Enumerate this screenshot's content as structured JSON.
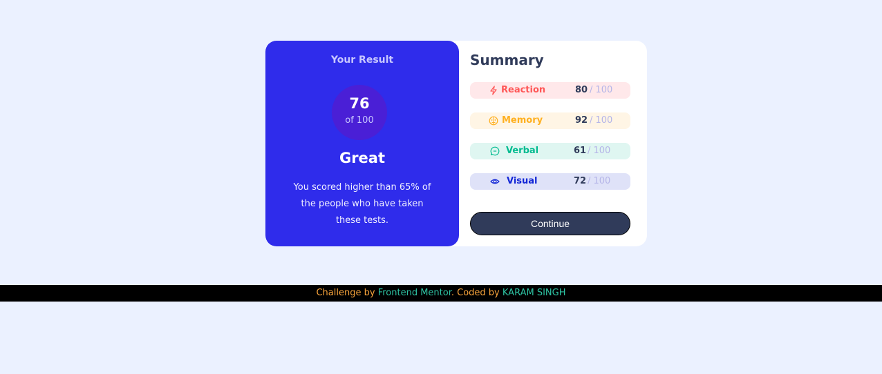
{
  "result": {
    "title": "Your Result",
    "score": "76",
    "score_of": "of 100",
    "rating": "Great",
    "description": "You scored higher than 65% of the people who have taken these tests."
  },
  "summary": {
    "title": "Summary",
    "items": [
      {
        "label": "Reaction",
        "score": "80",
        "total": "/ 100",
        "icon": "lightning-icon",
        "color": "#ff5757",
        "bg": "#ffe8ea"
      },
      {
        "label": "Memory",
        "score": "92",
        "total": "/ 100",
        "icon": "brain-icon",
        "color": "#ffb01f",
        "bg": "#fff5e5"
      },
      {
        "label": "Verbal",
        "score": "61",
        "total": "/ 100",
        "icon": "chat-icon",
        "color": "#00bb8f",
        "bg": "#dff6f1"
      },
      {
        "label": "Visual",
        "score": "72",
        "total": "/ 100",
        "icon": "eye-icon",
        "color": "#1125d6",
        "bg": "#dfe2f8"
      }
    ]
  },
  "continue_label": "Continue",
  "footer": {
    "prefix": "Challenge by ",
    "site": "Frontend Mentor",
    "middle": ". Coded by ",
    "author": "KARAM SINGH"
  },
  "colors": {
    "page_bg": "#ebf1ff",
    "result_bg": "#2f2ceb",
    "circle_bg": "#4a1fd6",
    "button_bg": "#303b5a",
    "footer_text": "#f8a43b",
    "footer_link": "#2ec4a4"
  }
}
